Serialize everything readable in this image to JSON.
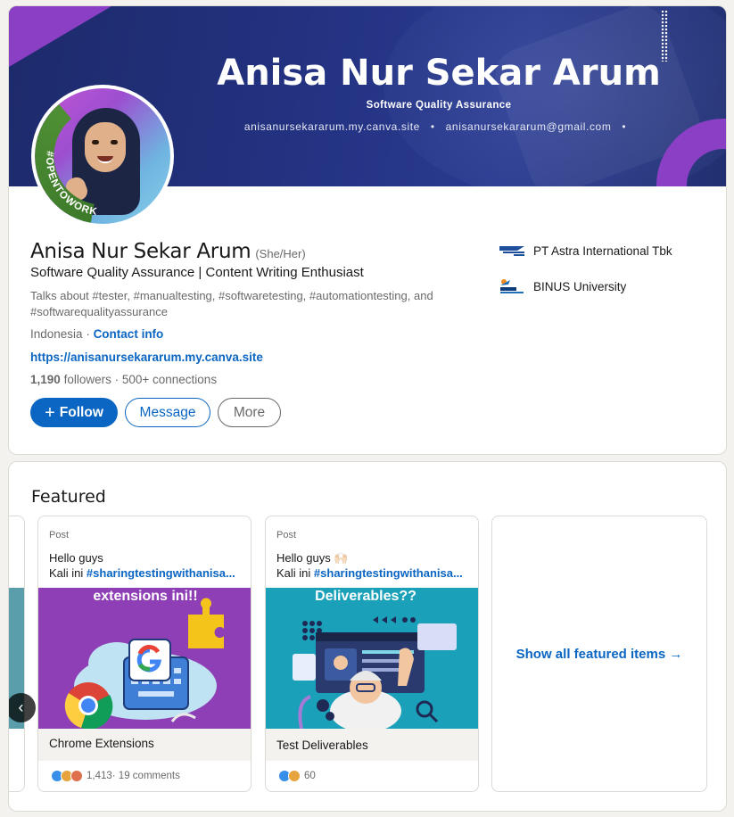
{
  "banner": {
    "name": "Anisa Nur Sekar Arum",
    "role": "Software Quality Assurance",
    "website": "anisanursekararum.my.canva.site",
    "email": "anisanursekararum@gmail.com",
    "sep": "•"
  },
  "avatar": {
    "tag": "#OPENTOWORK"
  },
  "profile": {
    "name": "Anisa Nur Sekar Arum",
    "pronouns": "(She/Her)",
    "headline": "Software Quality Assurance | Content Writing Enthusiast",
    "about": "Talks about #tester, #manualtesting, #softwaretesting, #automationtesting, and #softwarequalityassurance",
    "location": "Indonesia",
    "location_sep": " · ",
    "contact_info": "Contact info",
    "website": "https://anisanursekararum.my.canva.site",
    "followers_count": "1,190",
    "followers_label": "followers",
    "connections_sep": " · ",
    "connections": "500+ connections"
  },
  "buttons": {
    "follow": "Follow",
    "message": "Message",
    "more": "More"
  },
  "orgs": {
    "company": "PT Astra International Tbk",
    "school": "BINUS University"
  },
  "featured": {
    "title": "Featured",
    "items": [
      {
        "type": "Post",
        "line1": "Hello guys",
        "line2_prefix": "Kali ini ",
        "line2_tag": "#sharingtestingwithanisa...",
        "image_text": "extensions ini!!",
        "caption": "Chrome Extensions",
        "reactions_count": "1,413",
        "comments": " · 19 comments"
      },
      {
        "type": "Post",
        "line1": "Hello guys 🙌🏻",
        "line2_prefix": "Kali ini ",
        "line2_tag": "#sharingtestingwithanisa...",
        "image_text": "Deliverables??",
        "caption": "Test Deliverables",
        "reactions_count": "60"
      }
    ],
    "show_all": "Show all featured items →",
    "prev_arrow": "‹"
  },
  "colors": {
    "brand_blue": "#0a66c2",
    "banner_navy": "#243383",
    "accent_purple": "#8b3fc4",
    "open_to_work_green": "#4f8f34"
  }
}
